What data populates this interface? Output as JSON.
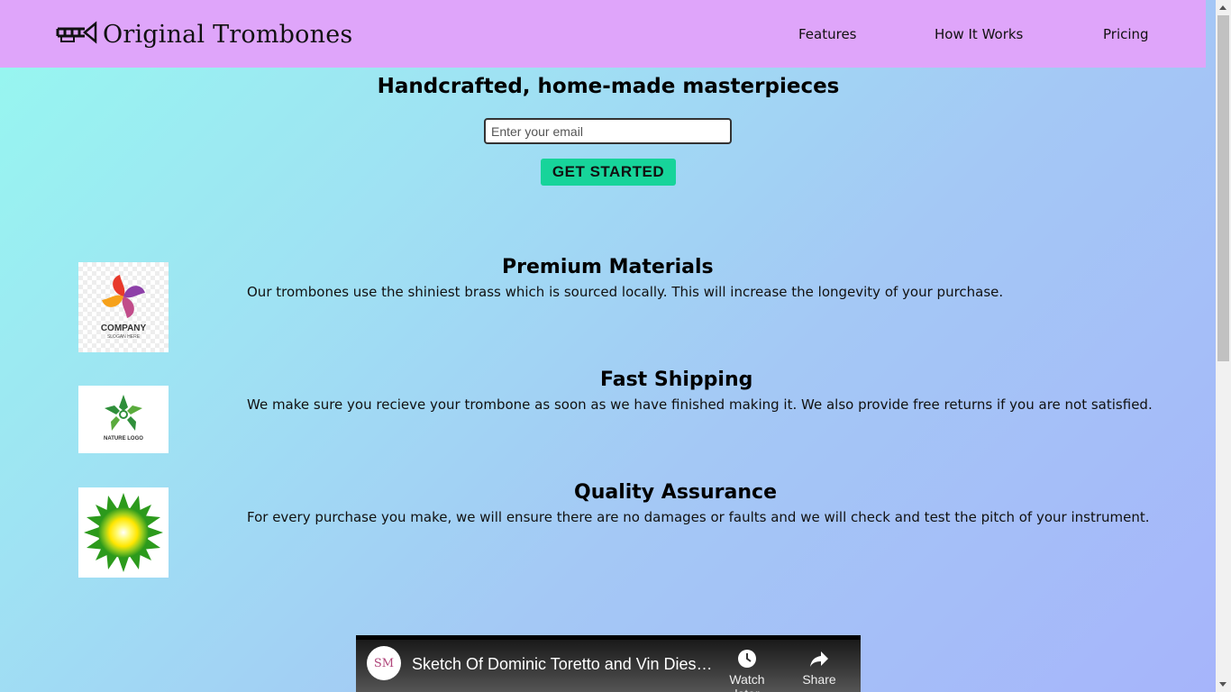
{
  "header": {
    "brand": "Original Trombones",
    "nav": [
      {
        "label": "Features"
      },
      {
        "label": "How It Works"
      },
      {
        "label": "Pricing"
      }
    ]
  },
  "hero": {
    "title": "Handcrafted, home-made masterpieces",
    "email_placeholder": "Enter your email",
    "cta_label": "GET STARTED"
  },
  "features": [
    {
      "title": "Premium Materials",
      "description": "Our trombones use the shiniest brass which is sourced locally. This will increase the longevity of your purchase.",
      "logo_icon": "company-logo-icon",
      "logo_text": "COMPANY",
      "logo_subtext": "SLOGAN HERE"
    },
    {
      "title": "Fast Shipping",
      "description": "We make sure you recieve your trombone as soon as we have finished making it. We also provide free returns if you are not satisfied.",
      "logo_icon": "nature-logo-icon",
      "logo_text": "NATURE LOGO"
    },
    {
      "title": "Quality Assurance",
      "description": "For every purchase you make, we will ensure there are no damages or faults and we will check and test the pitch of your instrument.",
      "logo_icon": "sunflower-logo-icon"
    }
  ],
  "video": {
    "title": "Sketch Of Dominic Toretto and Vin Dies…",
    "channel_initials": "SM",
    "watch_later_label": "Watch later",
    "share_label": "Share"
  },
  "colors": {
    "header_bg": "#dfa5fa",
    "cta_bg": "#17d49a"
  }
}
